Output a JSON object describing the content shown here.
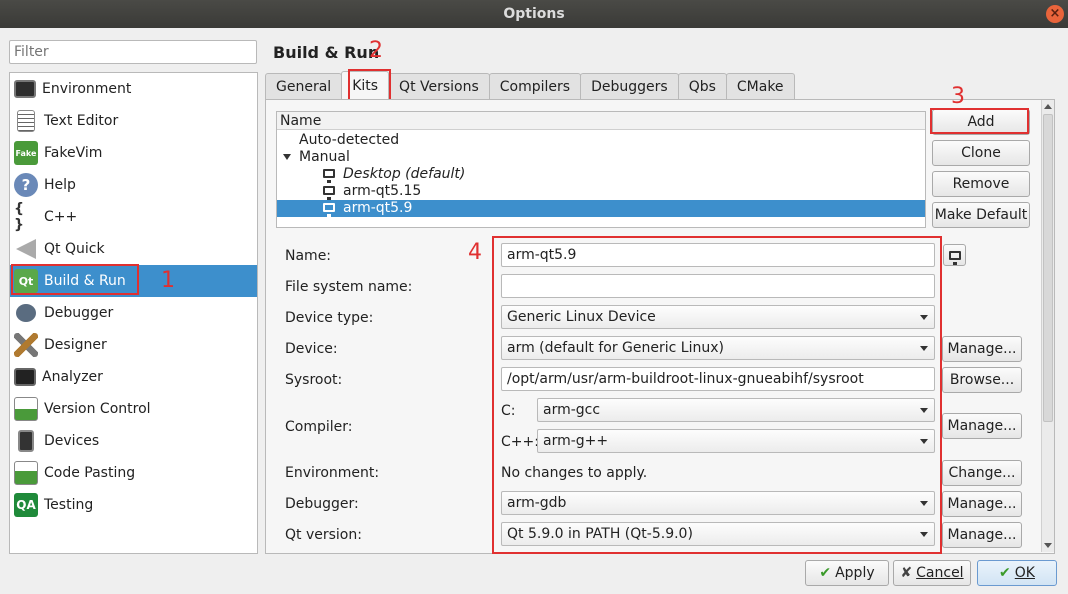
{
  "window": {
    "title": "Options",
    "close_glyph": "×"
  },
  "filter": {
    "placeholder": "Filter"
  },
  "sidebar": {
    "items": [
      {
        "label": "Environment",
        "icon": "environment-icon"
      },
      {
        "label": "Text Editor",
        "icon": "text-editor-icon"
      },
      {
        "label": "FakeVim",
        "icon": "fakevim-icon"
      },
      {
        "label": "Help",
        "icon": "help-icon"
      },
      {
        "label": "C++",
        "icon": "cpp-icon"
      },
      {
        "label": "Qt Quick",
        "icon": "qt-quick-icon"
      },
      {
        "label": "Build & Run",
        "icon": "build-run-icon",
        "selected": true
      },
      {
        "label": "Debugger",
        "icon": "debugger-icon"
      },
      {
        "label": "Designer",
        "icon": "designer-icon"
      },
      {
        "label": "Analyzer",
        "icon": "analyzer-icon"
      },
      {
        "label": "Version Control",
        "icon": "version-control-icon"
      },
      {
        "label": "Devices",
        "icon": "devices-icon"
      },
      {
        "label": "Code Pasting",
        "icon": "code-pasting-icon"
      },
      {
        "label": "Testing",
        "icon": "testing-icon"
      }
    ]
  },
  "icon_text": {
    "fakevim": "Fake",
    "cpp": "{ }",
    "qa": "QA",
    "help": "?",
    "qt": "Qt"
  },
  "annotations": {
    "n1": "1",
    "n2": "2",
    "n3": "3",
    "n4": "4"
  },
  "page": {
    "title": "Build & Run"
  },
  "tabs": [
    "General",
    "Kits",
    "Qt Versions",
    "Compilers",
    "Debuggers",
    "Qbs",
    "CMake"
  ],
  "active_tab": "Kits",
  "kit_tree": {
    "header": "Name",
    "auto_detected": "Auto-detected",
    "manual": "Manual",
    "kits": [
      "Desktop (default)",
      "arm-qt5.15",
      "arm-qt5.9"
    ],
    "selected_kit": "arm-qt5.9"
  },
  "kit_buttons": {
    "add": "Add",
    "clone": "Clone",
    "remove": "Remove",
    "make_default": "Make Default"
  },
  "form": {
    "name_label": "Name:",
    "name_value": "arm-qt5.9",
    "fs_name_label": "File system name:",
    "fs_name_value": "",
    "device_type_label": "Device type:",
    "device_type_value": "Generic Linux Device",
    "device_label": "Device:",
    "device_value": "arm (default for Generic Linux)",
    "sysroot_label": "Sysroot:",
    "sysroot_value": "/opt/arm/usr/arm-buildroot-linux-gnueabihf/sysroot",
    "compiler_label": "Compiler:",
    "c_label": "C:",
    "c_value": "arm-gcc",
    "cpp_label": "C++:",
    "cpp_value": "arm-g++",
    "environment_label": "Environment:",
    "environment_value": "No changes to apply.",
    "debugger_label": "Debugger:",
    "debugger_value": "arm-gdb",
    "qt_version_label": "Qt version:",
    "qt_version_value": "Qt 5.9.0 in PATH (Qt-5.9.0)",
    "manage": "Manage...",
    "browse": "Browse...",
    "change": "Change..."
  },
  "footer": {
    "apply": "Apply",
    "apply_glyph": "✔",
    "cancel": "Cancel",
    "cancel_glyph": "✘",
    "ok": "OK",
    "ok_glyph": "✔"
  },
  "colors": {
    "selection": "#3d8fcc",
    "annotation": "#e03030"
  }
}
